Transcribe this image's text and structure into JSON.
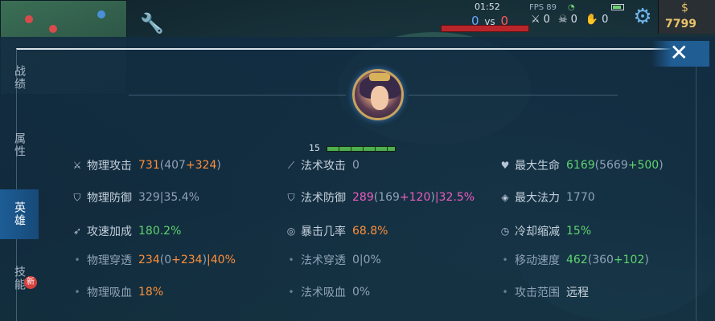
{
  "hud": {
    "match_time": "01:52",
    "fps": "FPS 89",
    "score_blue": "0",
    "score_vs": "vs",
    "score_red": "0",
    "kills": "0",
    "deaths": "0",
    "assists": "0",
    "gold": "7799"
  },
  "tabs": [
    {
      "label": "战绩",
      "active": false
    },
    {
      "label": "属性",
      "active": false
    },
    {
      "label": "英雄",
      "active": true
    },
    {
      "label": "技能",
      "active": false
    }
  ],
  "tabs_badge": "新",
  "close_label": "✕",
  "hero": {
    "level": "15"
  },
  "stats": {
    "col1": [
      {
        "icon": "sword-icon",
        "name": "物理攻击",
        "value": "731",
        "base": "(407",
        "bonus": "+324",
        "close": ")"
      },
      {
        "icon": "shield-icon",
        "name": "物理防御",
        "value": "329|35.4%"
      },
      {
        "icon": "attack-speed-icon",
        "name": "攻速加成",
        "value": "180.2%"
      },
      {
        "icon": "dot-icon",
        "name": "物理穿透",
        "value": "234",
        "base": "(0",
        "bonus": "+234",
        "close": ")",
        "extra": "|40%"
      },
      {
        "icon": "dot-icon",
        "name": "物理吸血",
        "value": "18%"
      }
    ],
    "col2": [
      {
        "icon": "wand-icon",
        "name": "法术攻击",
        "value": "0"
      },
      {
        "icon": "magic-shield-icon",
        "name": "法术防御",
        "value": "289",
        "base": "(169",
        "bonus": "+120",
        "close": ")",
        "extra": "|32.5%"
      },
      {
        "icon": "crit-icon",
        "name": "暴击几率",
        "value": "68.8%"
      },
      {
        "icon": "dot-icon",
        "name": "法术穿透",
        "value": "0|0%"
      },
      {
        "icon": "dot-icon",
        "name": "法术吸血",
        "value": "0%"
      }
    ],
    "col3": [
      {
        "icon": "heart-icon",
        "name": "最大生命",
        "value": "6169",
        "base": "(5669",
        "bonus": "+500",
        "close": ")"
      },
      {
        "icon": "mana-drop-icon",
        "name": "最大法力",
        "value": "1770"
      },
      {
        "icon": "cooldown-icon",
        "name": "冷却缩减",
        "value": "15%"
      },
      {
        "icon": "dot-icon",
        "name": "移动速度",
        "value": "462",
        "base": "(360",
        "bonus": "+102",
        "close": ")"
      },
      {
        "icon": "dot-icon",
        "name": "攻击范围",
        "value": "远程"
      }
    ]
  },
  "colors": {
    "orange": "#ff8f3a",
    "green": "#5fd36f",
    "pink": "#ef5cc0",
    "gray": "#8fa2b5"
  }
}
